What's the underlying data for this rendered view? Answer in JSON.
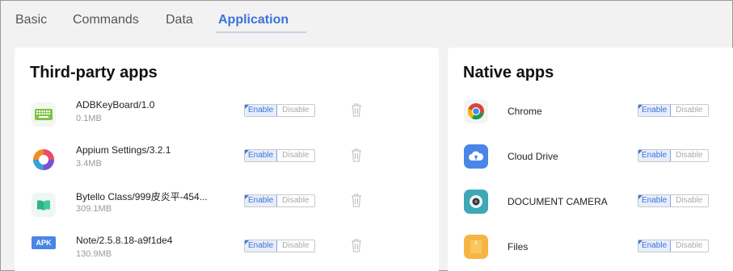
{
  "tabs": [
    {
      "label": "Basic"
    },
    {
      "label": "Commands"
    },
    {
      "label": "Data"
    },
    {
      "label": "Application"
    }
  ],
  "active_tab": "Application",
  "third_party": {
    "title": "Third-party apps",
    "apps": [
      {
        "name": "ADBKeyBoard/1.0",
        "size": "0.1MB",
        "icon": "keyboard-icon"
      },
      {
        "name": "Appium Settings/3.2.1",
        "size": "3.4MB",
        "icon": "appium-icon"
      },
      {
        "name": "Bytello Class/999皮炎平-454...",
        "size": "309.1MB",
        "icon": "book-icon"
      },
      {
        "name": "Note/2.5.8.18-a9f1de4",
        "size": "130.9MB",
        "icon": "apk-icon",
        "icon_text": "APK"
      }
    ]
  },
  "native": {
    "title": "Native apps",
    "apps": [
      {
        "name": "Chrome",
        "icon": "chrome-icon"
      },
      {
        "name": "Cloud Drive",
        "icon": "cloud-drive-icon"
      },
      {
        "name": "DOCUMENT CAMERA",
        "icon": "camera-icon"
      },
      {
        "name": "Files",
        "icon": "files-icon"
      }
    ]
  },
  "toggle": {
    "enable": "Enable",
    "disable": "Disable"
  },
  "colors": {
    "accent": "#3b72d9",
    "muted": "#999999"
  }
}
